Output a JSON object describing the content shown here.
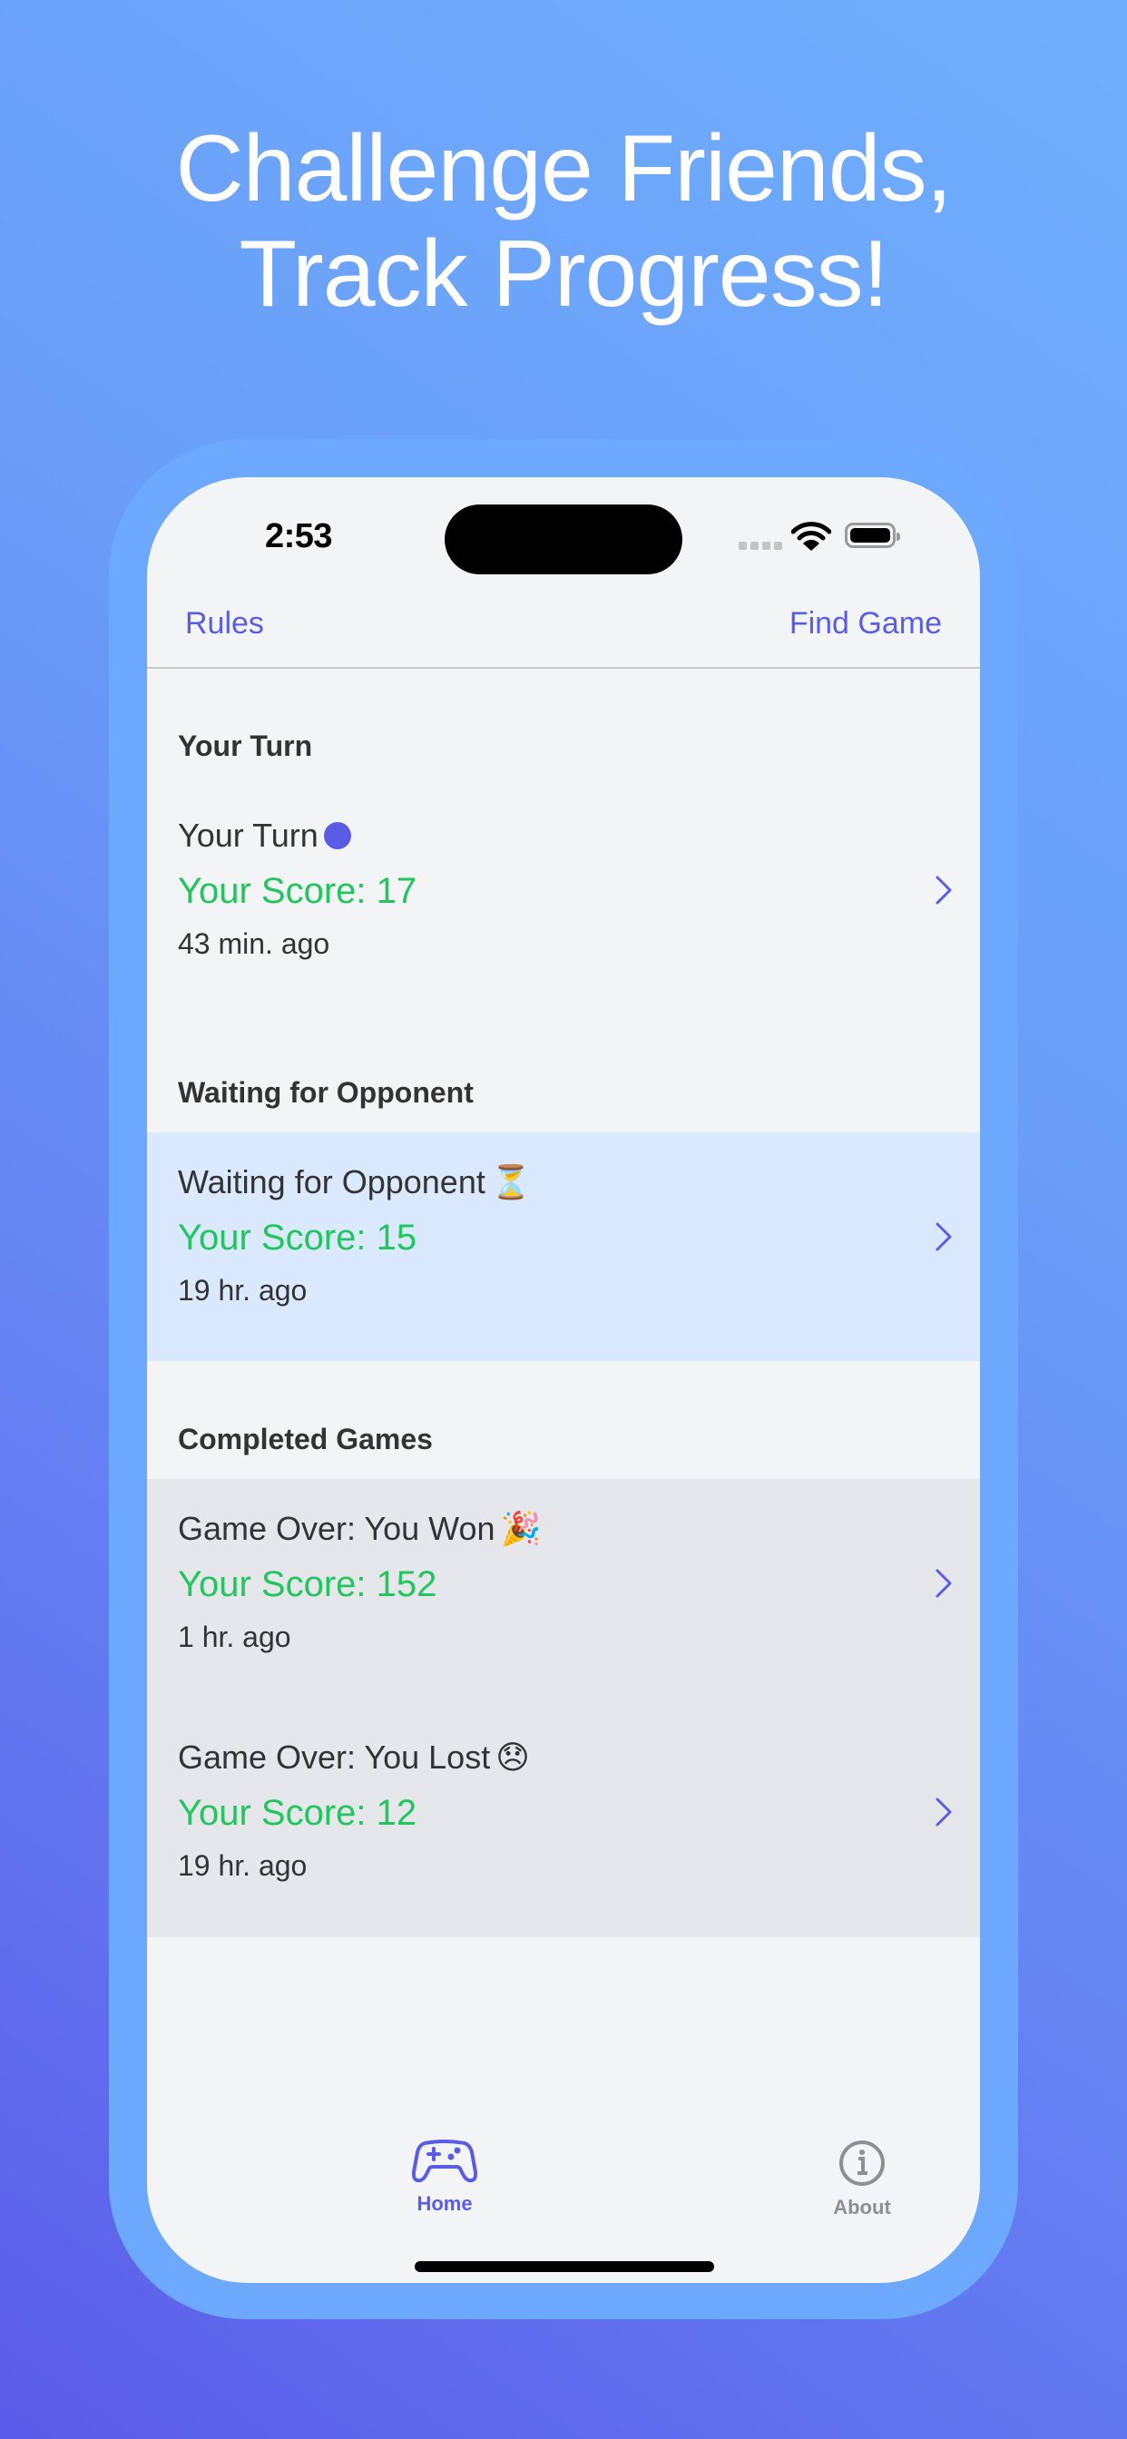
{
  "headline": {
    "line1": "Challenge Friends,",
    "line2": "Track Progress!"
  },
  "status_bar": {
    "time": "2:53",
    "signal_icon": "cellular-signal-icon",
    "wifi_icon": "wifi-icon",
    "battery_icon": "battery-icon"
  },
  "nav": {
    "left_label": "Rules",
    "right_label": "Find Game"
  },
  "sections": [
    {
      "title": "Your Turn",
      "games": [
        {
          "title": "Your Turn",
          "badge": "turn-indicator-dot",
          "score_label": "Your Score: 17",
          "ago": "43 min. ago"
        }
      ]
    },
    {
      "title": "Waiting for Opponent",
      "games": [
        {
          "title": "Waiting for Opponent",
          "emoji": "⏳",
          "score_label": "Your Score: 15",
          "ago": "19 hr. ago"
        }
      ]
    },
    {
      "title": "Completed Games",
      "games": [
        {
          "title": "Game Over: You Won",
          "emoji": "🎉",
          "score_label": "Your Score: 152",
          "ago": "1 hr. ago"
        },
        {
          "title": "Game Over: You Lost",
          "emoji": "😞",
          "score_label": "Your Score: 12",
          "ago": "19 hr. ago"
        }
      ]
    }
  ],
  "tab_bar": {
    "tabs": [
      {
        "label": "Home",
        "icon": "gamecontroller-icon",
        "active": true
      },
      {
        "label": "About",
        "icon": "info-circle-icon",
        "active": false
      }
    ]
  },
  "colors": {
    "accent": "#5b5ce6",
    "score_green": "#22c55e",
    "screen_bg": "#f3f4f6",
    "waiting_row_bg": "#dbe9fe",
    "completed_bg": "#e5e7eb",
    "frame": "#6ca8fb",
    "inactive_tab": "#8e8e93"
  }
}
